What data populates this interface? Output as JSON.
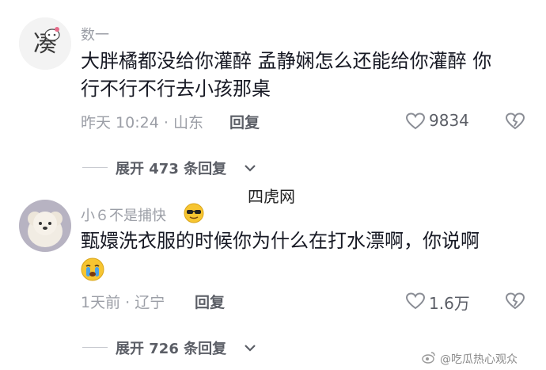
{
  "watermark": {
    "center": "四虎网",
    "corner": "@吃瓜热心观众"
  },
  "comments": [
    {
      "username": "数一",
      "text_lines": [
        "大胖橘都没给你灌醉 孟静娴怎么还能给你灌醉 你",
        "行不行不行去小孩那桌"
      ],
      "time": "昨天 10:24",
      "location": "山东",
      "reply_label": "回复",
      "likes": "9834",
      "expand_label": "展开 473 条回复"
    },
    {
      "username": "小６不是捕快",
      "text_lines": [
        "甄嬛洗衣服的时候你为什么在打水漂啊，你说啊"
      ],
      "time": "1天前",
      "location": "辽宁",
      "reply_label": "回复",
      "likes": "1.6万",
      "expand_label": "展开 726 条回复"
    }
  ],
  "icons": {
    "like": "heart-outline-icon",
    "dislike": "broken-heart-icon",
    "expand": "chevron-down-icon",
    "cool_emoji": "sunglasses-emoji-icon",
    "cry_emoji": "crying-emoji-icon"
  },
  "colors": {
    "secondary_text": "#9b9ea6",
    "primary_text": "#161823"
  }
}
